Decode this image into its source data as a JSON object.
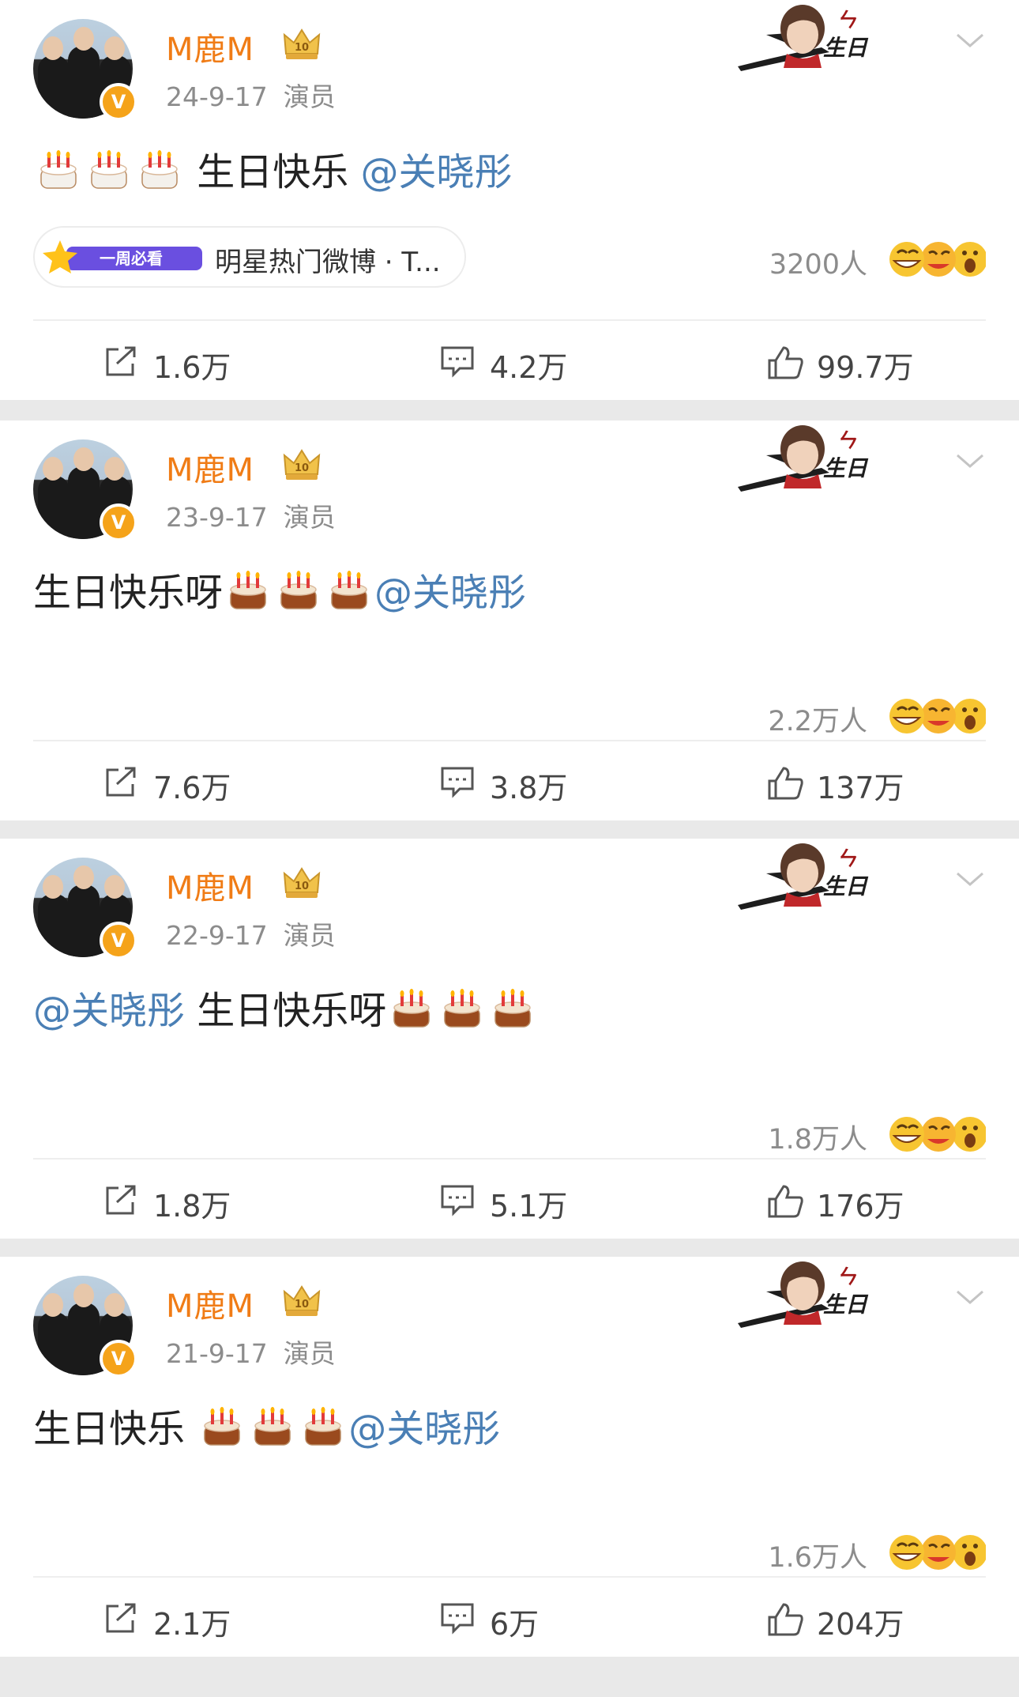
{
  "posts": [
    {
      "user": "M鹿M",
      "date": "24-9-17",
      "role": "演员",
      "content": {
        "before": "",
        "after": " 生日快乐 ",
        "mention": "@关晓彤",
        "mention_position": "end",
        "cake_count": 3,
        "cake_style": "white"
      },
      "topic": {
        "tag": "一周必看",
        "text": "明星热门微博 · T..."
      },
      "reaction_count": "3200人",
      "repost": "1.6万",
      "comment": "4.2万",
      "like": "99.7万"
    },
    {
      "user": "M鹿M",
      "date": "23-9-17",
      "role": "演员",
      "content": {
        "before": "生日快乐呀",
        "after": "",
        "mention": "@关晓彤",
        "mention_position": "end",
        "cake_count": 3,
        "cake_style": "brown"
      },
      "topic": null,
      "reaction_count": "2.2万人",
      "repost": "7.6万",
      "comment": "3.8万",
      "like": "137万"
    },
    {
      "user": "M鹿M",
      "date": "22-9-17",
      "role": "演员",
      "content": {
        "before": " 生日快乐呀",
        "after": "",
        "mention": "@关晓彤",
        "mention_position": "start",
        "cake_count": 3,
        "cake_style": "brown"
      },
      "topic": null,
      "reaction_count": "1.8万人",
      "repost": "1.8万",
      "comment": "5.1万",
      "like": "176万"
    },
    {
      "user": "M鹿M",
      "date": "21-9-17",
      "role": "演员",
      "content": {
        "before": "生日快乐 ",
        "after": "",
        "mention": "@关晓彤",
        "mention_position": "end",
        "cake_count": 3,
        "cake_style": "brown"
      },
      "topic": null,
      "reaction_count": "1.6万人",
      "repost": "2.1万",
      "comment": "6万",
      "like": "204万"
    }
  ],
  "colors": {
    "username": "#f07c16",
    "mention": "#4a7fb5",
    "meta": "#8c8c8c",
    "badge": "#f5a31a",
    "separator": "#e9e9e9"
  },
  "icons": [
    "crown-icon",
    "chevron-down-icon",
    "repost-icon",
    "comment-icon",
    "like-icon",
    "cake-icon",
    "reaction-faces-icon",
    "verified-badge-icon"
  ]
}
